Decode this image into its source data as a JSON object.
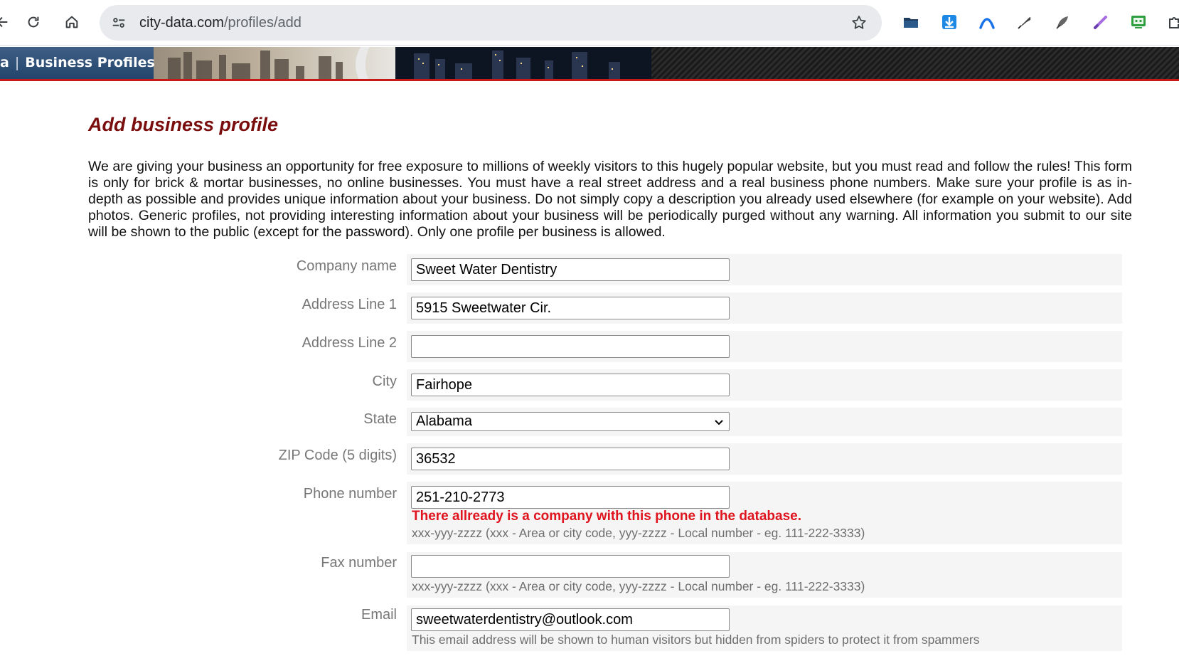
{
  "browser": {
    "url_domain": "city-data.com",
    "url_path": "/profiles/add",
    "extensions": [
      "folder-icon",
      "download-arrow-icon",
      "arc-icon",
      "feather-pen-icon",
      "quill-icon",
      "purple-pen-icon",
      "green-screen-icon",
      "puzzle-icon"
    ]
  },
  "banner": {
    "prefix": "a",
    "label": "Business Profiles"
  },
  "page": {
    "title": "Add business profile",
    "intro": "We are giving your business an opportunity for free exposure to millions of weekly visitors to this hugely popular website, but you must read and follow the rules! This form is only for brick & mortar businesses, no online businesses. You must have a real street address and a real business phone numbers. Make sure your profile is as in-depth as possible and provides unique information about your business. Do not simply copy a description you already used elsewhere (for example on your website). Add photos. Generic profiles, not providing interesting information about your business will be periodically purged without any warning. All information you submit to our site will be shown to the public (except for the password). Only one profile per business is allowed."
  },
  "form": {
    "company": {
      "label": "Company name",
      "value": "Sweet Water Dentistry"
    },
    "address1": {
      "label": "Address Line 1",
      "value": "5915 Sweetwater Cir."
    },
    "address2": {
      "label": "Address Line 2",
      "value": ""
    },
    "city": {
      "label": "City",
      "value": "Fairhope"
    },
    "state": {
      "label": "State",
      "value": "Alabama"
    },
    "zip": {
      "label": "ZIP Code (5 digits)",
      "value": "36532"
    },
    "phone": {
      "label": "Phone number",
      "value": "251-210-2773",
      "error": "There allready is a company with this phone in the database.",
      "hint": "xxx-yyy-zzzz (xxx - Area or city code, yyy-zzzz - Local number - eg. 111-222-3333)"
    },
    "fax": {
      "label": "Fax number",
      "value": "",
      "hint": "xxx-yyy-zzzz (xxx - Area or city code, yyy-zzzz - Local number - eg. 111-222-3333)"
    },
    "email": {
      "label": "Email",
      "value": "sweetwaterdentistry@outlook.com",
      "hint": "This email address will be shown to human visitors but hidden from spiders to protect it from spammers"
    }
  },
  "colors": {
    "title": "#7a0d0d",
    "error": "#e0141e",
    "banner_accent": "#c81818",
    "banner_label": "#2f5077"
  }
}
